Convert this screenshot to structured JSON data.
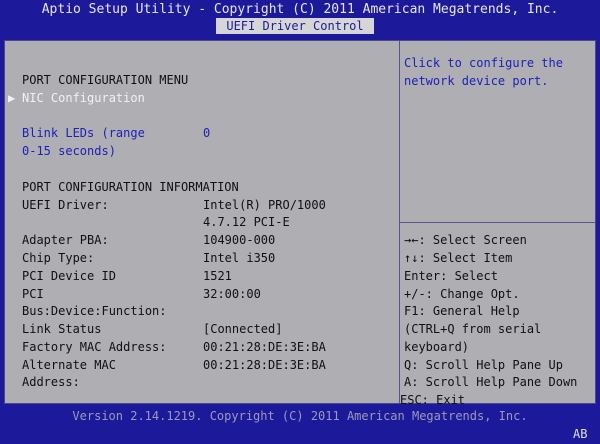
{
  "header": {
    "app_title": "Aptio Setup Utility - Copyright (C) 2011 American Megatrends, Inc.",
    "tab": "UEFI Driver Control"
  },
  "left": {
    "menu_title": "PORT CONFIGURATION MENU",
    "nic_cursor": "▶",
    "nic_label": "NIC Configuration",
    "blink_label_1": "Blink LEDs (range",
    "blink_label_2": "0-15 seconds)",
    "blink_value": "0",
    "info_title": "PORT CONFIGURATION INFORMATION",
    "rows": [
      {
        "label": "UEFI Driver:",
        "value": "Intel(R) PRO/1000"
      },
      {
        "label": "",
        "value": "4.7.12 PCI-E"
      },
      {
        "label": "Adapter PBA:",
        "value": "104900-000"
      },
      {
        "label": "Chip Type:",
        "value": "Intel i350"
      },
      {
        "label": "PCI Device ID",
        "value": "1521"
      },
      {
        "label": "PCI",
        "value": "32:00:00"
      },
      {
        "label": "Bus:Device:Function:",
        "value": ""
      },
      {
        "label": "Link Status",
        "value": "[Connected]"
      },
      {
        "label": "Factory MAC Address:",
        "value": "00:21:28:DE:3E:BA"
      },
      {
        "label": "Alternate MAC",
        "value": "00:21:28:DE:3E:BA"
      },
      {
        "label": "Address:",
        "value": ""
      }
    ]
  },
  "right": {
    "help_1": "Click to configure the",
    "help_2": "network device port.",
    "keys": [
      "→←: Select Screen",
      "↑↓: Select Item",
      "Enter: Select",
      "+/-: Change Opt.",
      "F1: General Help",
      "(CTRL+Q from serial",
      "keyboard)",
      "Q: Scroll Help Pane Up",
      "A: Scroll Help Pane Down",
      "ESC: Exit"
    ]
  },
  "footer": {
    "version": "Version 2.14.1219. Copyright (C) 2011 American Megatrends, Inc.",
    "badge": "AB"
  },
  "colors": {
    "background": "#1c1a9a",
    "panel": "#aeaeb3",
    "highlight_text": "#f2f2f2",
    "option_text": "#2020b8"
  }
}
